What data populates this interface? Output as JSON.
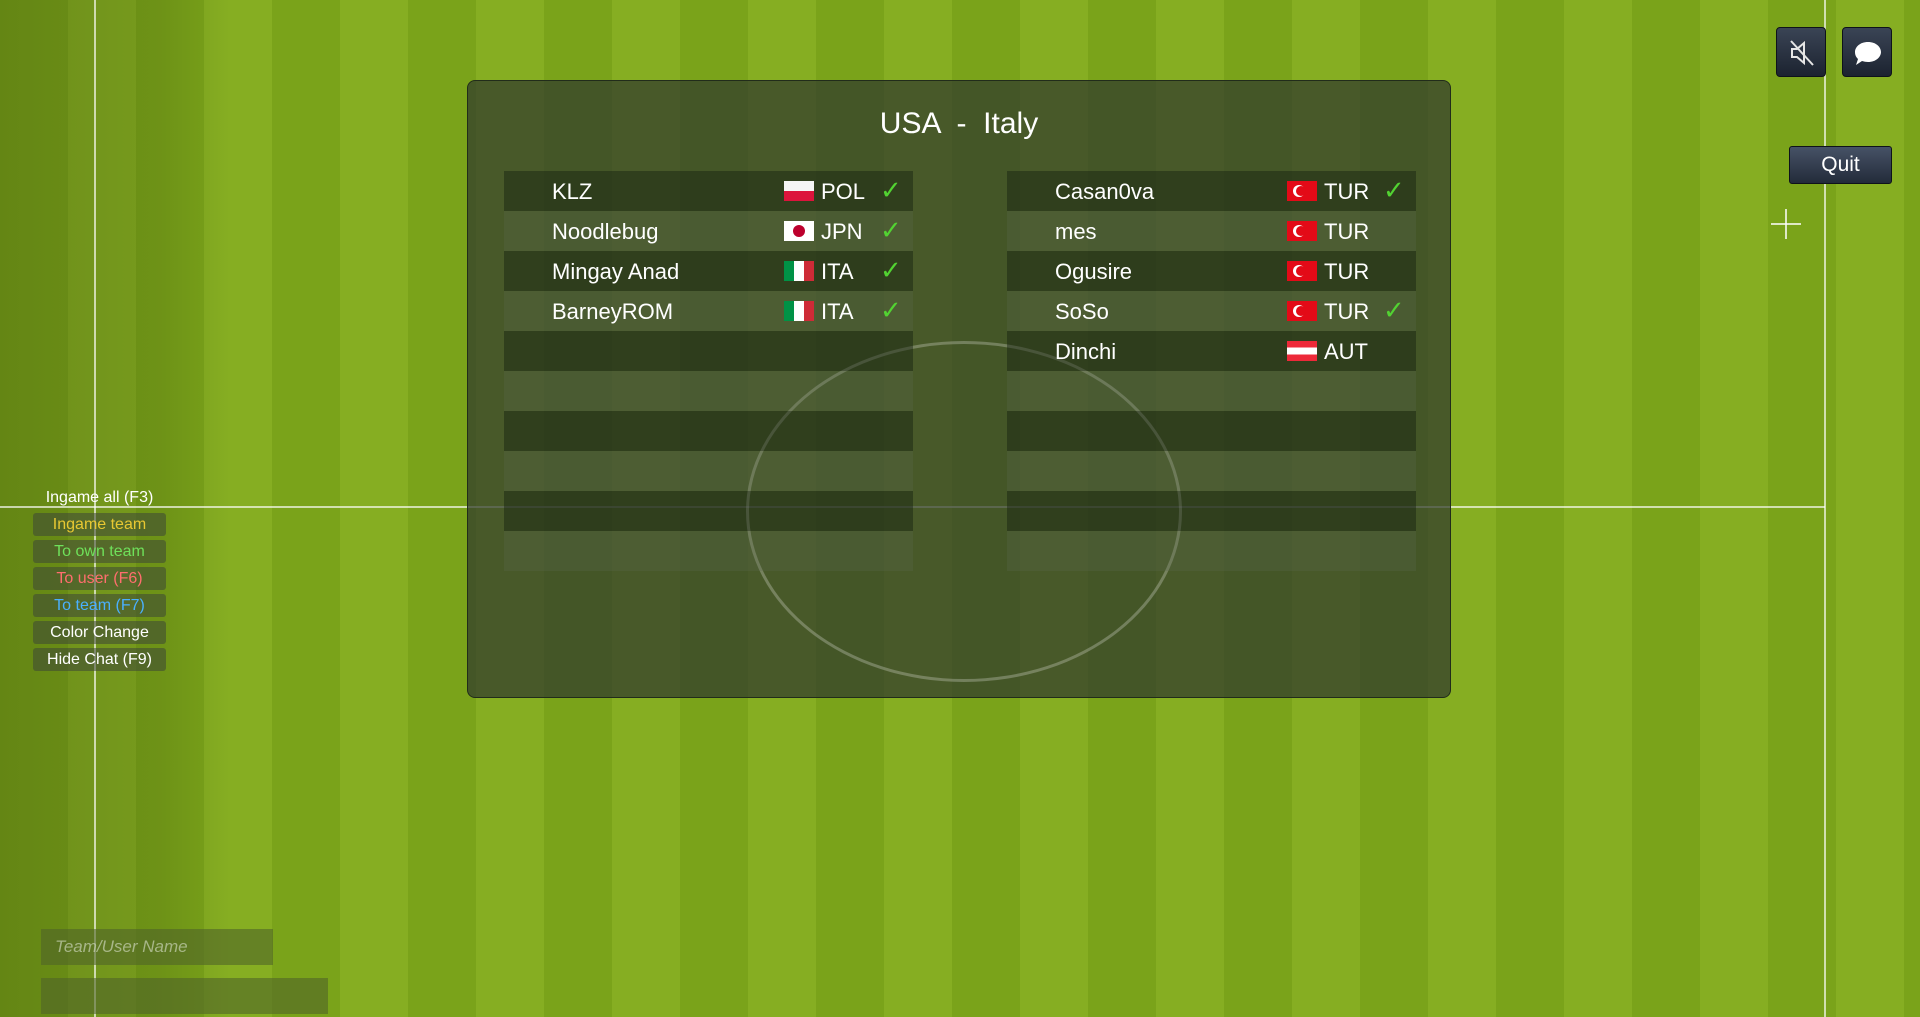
{
  "match": {
    "home": "USA",
    "separator": "-",
    "away": "Italy"
  },
  "home_players": [
    {
      "name": "KLZ",
      "country": "POL",
      "flag": "pol",
      "ready": "✓"
    },
    {
      "name": "Noodlebug",
      "country": "JPN",
      "flag": "jpn",
      "ready": "✓"
    },
    {
      "name": "Mingay Anad",
      "country": "ITA",
      "flag": "ita",
      "ready": "✓"
    },
    {
      "name": "BarneyROM",
      "country": "ITA",
      "flag": "ita",
      "ready": "✓"
    }
  ],
  "away_players": [
    {
      "name": "Casan0va",
      "country": "TUR",
      "flag": "tur",
      "ready": "✓"
    },
    {
      "name": "mes",
      "country": "TUR",
      "flag": "tur",
      "ready": ""
    },
    {
      "name": "Ogusire",
      "country": "TUR",
      "flag": "tur",
      "ready": ""
    },
    {
      "name": "SoSo",
      "country": "TUR",
      "flag": "tur",
      "ready": "✓"
    },
    {
      "name": "Dinchi",
      "country": "AUT",
      "flag": "aut",
      "ready": ""
    }
  ],
  "top_icons": {
    "mute": "speaker-muted-icon",
    "chat": "chat-bubble-icon",
    "crosshair": "crosshair-icon"
  },
  "quit_label": "Quit",
  "chat_options": [
    {
      "label": "Ingame all (F3)",
      "color": "#ffffff"
    },
    {
      "label": "Ingame team",
      "color": "#e8c832"
    },
    {
      "label": "To own team",
      "color": "#6fe05a"
    },
    {
      "label": "To user (F6)",
      "color": "#ff6e6e"
    },
    {
      "label": "To team (F7)",
      "color": "#4ab0ff"
    },
    {
      "label": "Color Change",
      "color": "#ffffff"
    },
    {
      "label": "Hide Chat (F9)",
      "color": "#ffffff"
    }
  ],
  "chat_input": {
    "name_placeholder": "Team/User Name",
    "message_value": ""
  }
}
